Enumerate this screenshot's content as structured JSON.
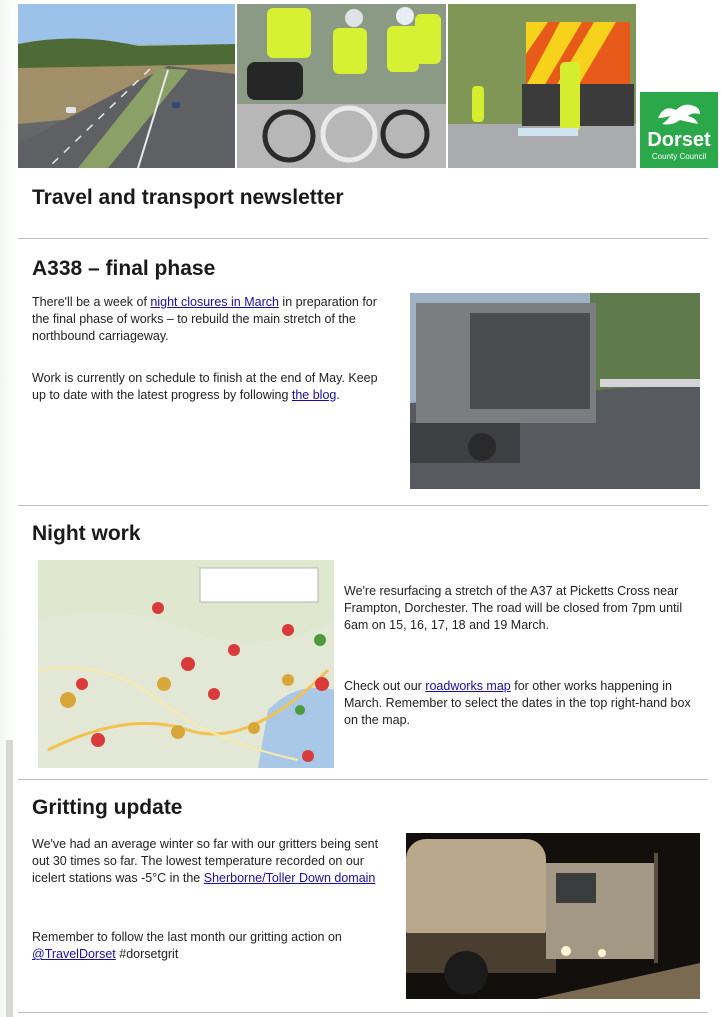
{
  "banner": {
    "logo_name": "Dorset",
    "logo_sub": "County Council"
  },
  "newsletter_title": "Travel and transport newsletter",
  "sections": [
    {
      "heading": "A338 – final phase",
      "paragraphs": [
        [
          "There'll be a week of ",
          "night closures in March",
          " in preparation for the final phase of works – to rebuild the main stretch of the northbound carriageway."
        ],
        [
          "Work is currently on schedule to finish at the end of May. Keep up to date with the latest progress by following ",
          "the blog",
          "."
        ]
      ]
    },
    {
      "heading": "Night work",
      "paragraphs": [
        [
          "We're resurfacing a stretch of the A37 at Picketts Cross near Frampton, Dorchester. The road will be closed from 7pm until 6am on 15, 16, 17, 18 and 19 March."
        ],
        [
          "Check out our ",
          "roadworks map",
          " for other works happening in March. Remember to select the dates in the top right-hand box on the map."
        ]
      ]
    },
    {
      "heading": "Gritting update",
      "paragraphs": [
        [
          "We've had an average winter so far with our gritters being sent out 30 times so far. The lowest temperature recorded on our icelert stations was -5°C in the ",
          "Sherborne/Toller Down domain",
          ""
        ],
        [
          "Remember to follow the last month our gritting action on ",
          "@TravelDorset",
          " #dorsetgrit"
        ]
      ]
    }
  ],
  "colors": {
    "brand_green": "#2aa84a",
    "link": "#1a0dab",
    "rule": "#bdbdbd"
  }
}
